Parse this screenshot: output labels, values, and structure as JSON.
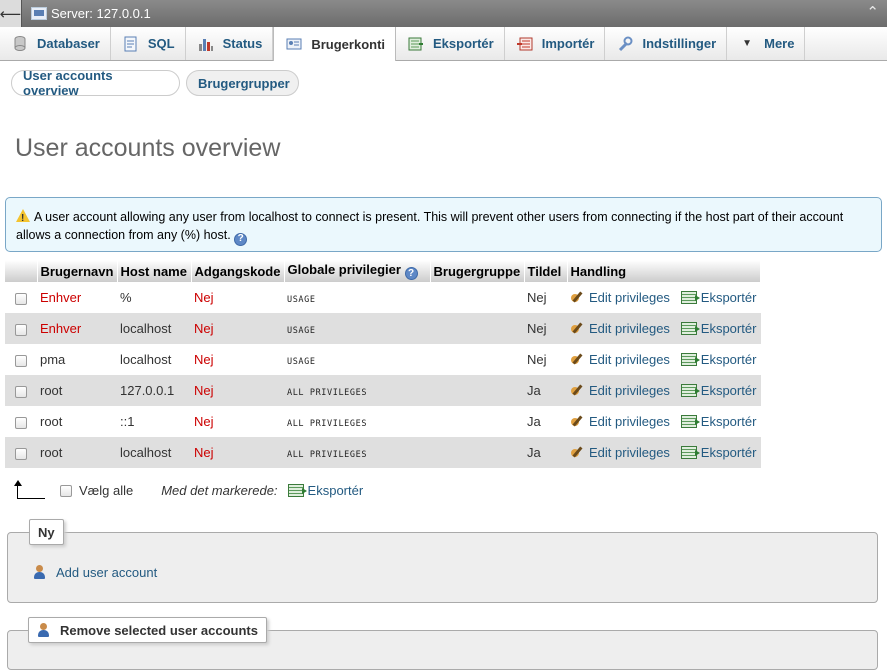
{
  "topbar": {
    "title": "Server: 127.0.0.1",
    "back_icon": "back-arrow-icon",
    "collapse_icon": "collapse-icon"
  },
  "tabs": [
    {
      "label": "Databaser",
      "icon": "database-icon",
      "active": false
    },
    {
      "label": "SQL",
      "icon": "sql-icon",
      "active": false
    },
    {
      "label": "Status",
      "icon": "status-icon",
      "active": false
    },
    {
      "label": "Brugerkonti",
      "icon": "user-accounts-icon",
      "active": true
    },
    {
      "label": "Eksportér",
      "icon": "export-icon",
      "active": false
    },
    {
      "label": "Importér",
      "icon": "import-icon",
      "active": false
    },
    {
      "label": "Indstillinger",
      "icon": "settings-icon",
      "active": false
    },
    {
      "label": "Mere",
      "icon": "dropdown-icon",
      "active": false
    }
  ],
  "subtabs": {
    "overview": "User accounts overview",
    "groups": "Brugergrupper"
  },
  "page_title": "User accounts overview",
  "notice": {
    "text": "A user account allowing any user from localhost to connect is present. This will prevent other users from connecting if the host part of their account allows a connection from any (%) host."
  },
  "table": {
    "headers": {
      "username": "Brugernavn",
      "host": "Host name",
      "password": "Adgangskode",
      "global_privileges": "Globale privilegier",
      "user_group": "Brugergruppe",
      "grant": "Tildel",
      "action": "Handling"
    },
    "edit_label": "Edit privileges",
    "export_label": "Eksportér",
    "rows": [
      {
        "user": "Enhver",
        "host": "%",
        "password": "Nej",
        "privileges": "USAGE",
        "group": "",
        "grant": "Nej"
      },
      {
        "user": "Enhver",
        "host": "localhost",
        "password": "Nej",
        "privileges": "USAGE",
        "group": "",
        "grant": "Nej"
      },
      {
        "user": "pma",
        "host": "localhost",
        "password": "Nej",
        "privileges": "USAGE",
        "group": "",
        "grant": "Nej"
      },
      {
        "user": "root",
        "host": "127.0.0.1",
        "password": "Nej",
        "privileges": "ALL PRIVILEGES",
        "group": "",
        "grant": "Ja"
      },
      {
        "user": "root",
        "host": "::1",
        "password": "Nej",
        "privileges": "ALL PRIVILEGES",
        "group": "",
        "grant": "Ja"
      },
      {
        "user": "root",
        "host": "localhost",
        "password": "Nej",
        "privileges": "ALL PRIVILEGES",
        "group": "",
        "grant": "Ja"
      }
    ]
  },
  "bulk": {
    "select_all": "Vælg alle",
    "with_selected": "Med det markerede:",
    "export": "Eksportér"
  },
  "new_section": {
    "legend": "Ny",
    "add_user": "Add user account"
  },
  "remove_section": {
    "legend": "Remove selected user accounts"
  },
  "colors": {
    "link": "#235a81",
    "no_value": "#cc0000",
    "notice_bg": "#ebf8fd",
    "row_alt": "#dfdfdf"
  }
}
